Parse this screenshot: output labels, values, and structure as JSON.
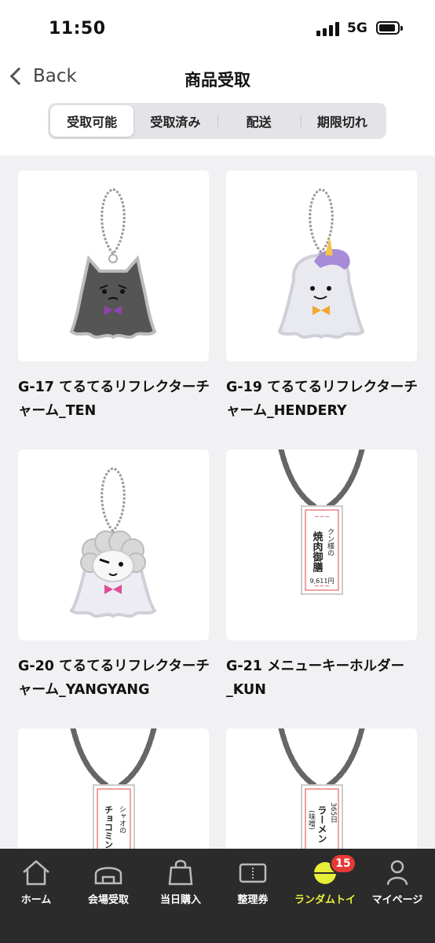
{
  "status_bar": {
    "time": "11:50",
    "network": "5G"
  },
  "nav": {
    "back_label": "Back",
    "title": "商品受取"
  },
  "tabs": [
    {
      "label": "受取可能",
      "active": true
    },
    {
      "label": "受取済み",
      "active": false
    },
    {
      "label": "配送",
      "active": false
    },
    {
      "label": "期限切れ",
      "active": false
    }
  ],
  "items": [
    {
      "title": "G-17 てるてるリフレクターチャーム_TEN",
      "image": "gray-cat-teru-teru-reflector-charm"
    },
    {
      "title": "G-19 てるてるリフレクターチャーム_HENDERY",
      "image": "unicorn-teru-teru-reflector-charm"
    },
    {
      "title": "G-20 てるてるリフレクターチャーム_YANGYANG",
      "image": "sheep-teru-teru-reflector-charm"
    },
    {
      "title": "G-21 メニューキーホルダー_KUN",
      "image": "menu-key-holder",
      "tag_line1": "クン様の",
      "tag_line2": "焼肉御膳",
      "tag_price": "9,611円"
    },
    {
      "title": "",
      "image": "menu-key-holder",
      "tag_line1": "シャオの",
      "tag_line2": "チョコミントアイス"
    },
    {
      "title": "",
      "image": "menu-key-holder",
      "tag_line1": "365日",
      "tag_line2": "ラーメン",
      "tag_line3": "(味噌)"
    }
  ],
  "bottom_nav": [
    {
      "label": "ホーム",
      "icon": "home-icon",
      "active": false
    },
    {
      "label": "会場受取",
      "icon": "venue-icon",
      "active": false
    },
    {
      "label": "当日購入",
      "icon": "shopping-bag-icon",
      "active": false
    },
    {
      "label": "整理券",
      "icon": "ticket-icon",
      "active": false
    },
    {
      "label": "ランダムトイ",
      "icon": "random-toy-icon",
      "active": true,
      "badge": "15"
    },
    {
      "label": "マイページ",
      "icon": "person-icon",
      "active": false
    }
  ],
  "colors": {
    "active_tab_text": "#e8ef38",
    "badge": "#e53935",
    "bottom_bar": "#2b2b2b"
  }
}
